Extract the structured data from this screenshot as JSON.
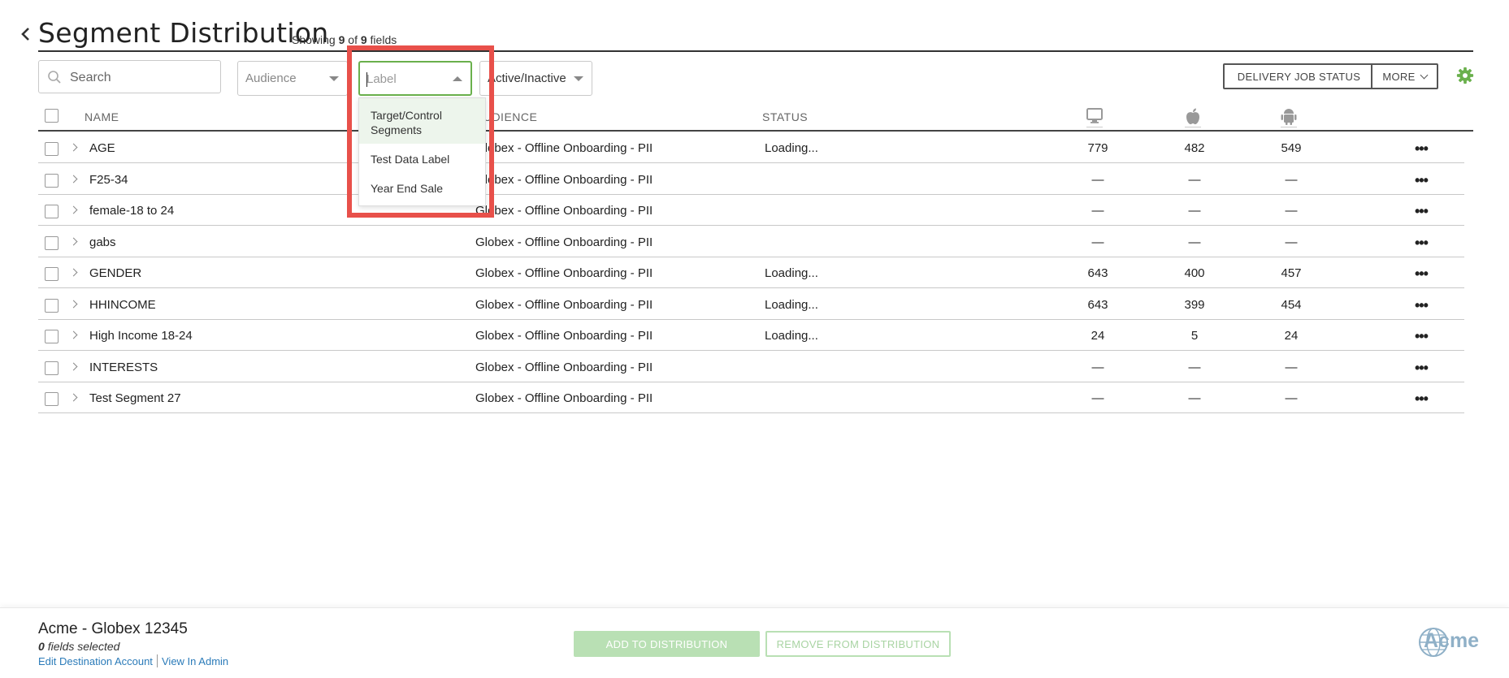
{
  "header": {
    "title": "Segment Distribution",
    "showing_prefix": "Showing",
    "showing_count": "9",
    "showing_of": "of",
    "showing_total": "9",
    "showing_suffix": "fields"
  },
  "toolbar": {
    "search_placeholder": "Search",
    "audience_filter": "Audience",
    "label_filter_placeholder": "Label",
    "active_filter": "Active/Inactive",
    "delivery_button": "DELIVERY JOB STATUS",
    "more_button": "MORE"
  },
  "label_dropdown": {
    "options": [
      "Target/Control Segments",
      "Test Data Label",
      "Year End Sale"
    ],
    "highlighted_index": 0,
    "highlight_color": "#e8504a"
  },
  "table": {
    "columns": {
      "name": "NAME",
      "audience": "AUDIENCE",
      "status": "STATUS",
      "desktop": "desktop-icon",
      "ios": "apple-icon",
      "android": "android-icon"
    },
    "rows": [
      {
        "name": "AGE",
        "audience": "Globex - Offline Onboarding - PII",
        "status": "Loading...",
        "desktop": "779",
        "ios": "482",
        "android": "549"
      },
      {
        "name": "F25-34",
        "audience": "Globex - Offline Onboarding - PII",
        "status": "",
        "desktop": "—",
        "ios": "—",
        "android": "—"
      },
      {
        "name": "female-18 to 24",
        "audience": "Globex - Offline Onboarding - PII",
        "status": "",
        "desktop": "—",
        "ios": "—",
        "android": "—"
      },
      {
        "name": "gabs",
        "audience": "Globex - Offline Onboarding - PII",
        "status": "",
        "desktop": "—",
        "ios": "—",
        "android": "—"
      },
      {
        "name": "GENDER",
        "audience": "Globex - Offline Onboarding - PII",
        "status": "Loading...",
        "desktop": "643",
        "ios": "400",
        "android": "457"
      },
      {
        "name": "HHINCOME",
        "audience": "Globex - Offline Onboarding - PII",
        "status": "Loading...",
        "desktop": "643",
        "ios": "399",
        "android": "454"
      },
      {
        "name": "High Income 18-24",
        "audience": "Globex - Offline Onboarding - PII",
        "status": "Loading...",
        "desktop": "24",
        "ios": "5",
        "android": "24"
      },
      {
        "name": "INTERESTS",
        "audience": "Globex - Offline Onboarding - PII",
        "status": "",
        "desktop": "—",
        "ios": "—",
        "android": "—"
      },
      {
        "name": "Test Segment 27",
        "audience": "Globex - Offline Onboarding - PII",
        "status": "",
        "desktop": "—",
        "ios": "—",
        "android": "—"
      }
    ],
    "row_menu": "•••"
  },
  "footer": {
    "account_name": "Acme - Globex 12345",
    "selected_count": "0",
    "selected_suffix": "fields selected",
    "edit_link": "Edit Destination Account",
    "admin_link": "View In Admin",
    "add_button": "ADD TO DISTRIBUTION",
    "remove_button": "REMOVE FROM DISTRIBUTION",
    "brand": "Acme"
  },
  "colors": {
    "accent_green": "#6ab04c",
    "link_blue": "#2b7bb9",
    "disabled_green": "#b9e0b4",
    "highlight_red": "#e8504a"
  }
}
